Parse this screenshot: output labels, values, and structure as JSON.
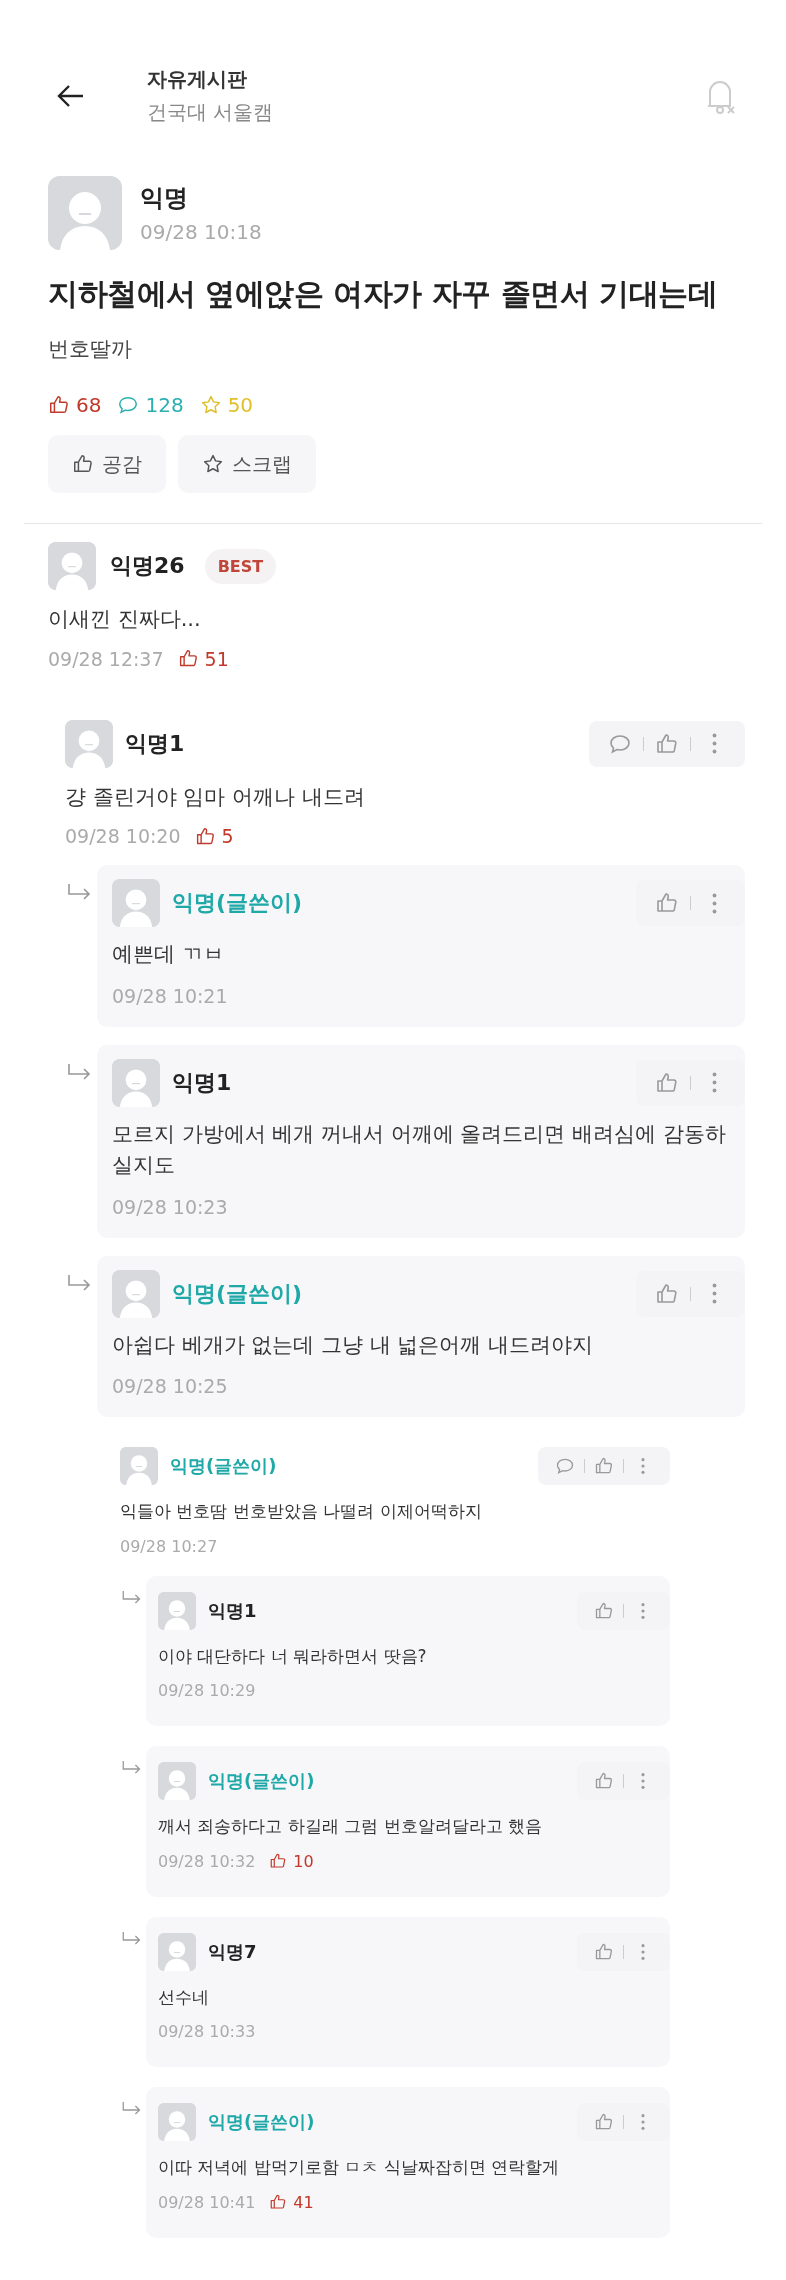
{
  "header": {
    "title": "자유게시판",
    "subtitle": "건국대 서울캠"
  },
  "post": {
    "author": "익명",
    "time": "09/28 10:18",
    "title": "지하철에서 옆에앉은 여자가 자꾸 졸면서 기대는데",
    "body": "번호딸까",
    "stats": {
      "likes": "68",
      "comments": "128",
      "scraps": "50"
    },
    "buttons": [
      {
        "kind": "like",
        "label": "공감"
      },
      {
        "kind": "scrap",
        "label": "스크랩"
      }
    ]
  },
  "best_comment": {
    "author": "익명26",
    "badge": "BEST",
    "body": "이새낀 진짜다...",
    "time": "09/28 12:37",
    "likes": "51"
  },
  "threads": [
    {
      "author": "익명1",
      "writer": false,
      "body": "걍 졸린거야 임마 어깨나 내드려",
      "time": "09/28 10:20",
      "likes": "5",
      "actions": [
        {
          "kind": "reply"
        },
        {
          "kind": "like"
        },
        {
          "kind": "more"
        }
      ],
      "replies": [
        {
          "author": "익명(글쓴이)",
          "writer": true,
          "body": "예쁜데 ㄲㅂ",
          "time": "09/28 10:21",
          "actions": [
            {
              "kind": "like"
            },
            {
              "kind": "more"
            }
          ]
        },
        {
          "author": "익명1",
          "writer": false,
          "body": "모르지 가방에서 베개 꺼내서 어깨에 올려드리면 배려심에 감동하실지도",
          "time": "09/28 10:23",
          "actions": [
            {
              "kind": "like"
            },
            {
              "kind": "more"
            }
          ]
        },
        {
          "author": "익명(글쓴이)",
          "writer": true,
          "body": "아쉽다 베개가 없는데 그냥 내 넓은어깨 내드려야지",
          "time": "09/28 10:25",
          "actions": [
            {
              "kind": "like"
            },
            {
              "kind": "more"
            }
          ]
        }
      ]
    },
    {
      "author": "익명(글쓴이)",
      "writer": true,
      "body": "익들아 번호땀 번호받았음 나떨려 이제어떡하지",
      "time": "09/28 10:27",
      "actions": [
        {
          "kind": "reply"
        },
        {
          "kind": "like"
        },
        {
          "kind": "more"
        }
      ],
      "replies": [
        {
          "author": "익명1",
          "writer": false,
          "body": "이야 대단하다 너 뭐라하면서 땃음?",
          "time": "09/28 10:29",
          "actions": [
            {
              "kind": "like"
            },
            {
              "kind": "more"
            }
          ]
        },
        {
          "author": "익명(글쓴이)",
          "writer": true,
          "body": "깨서 죄송하다고 하길래 그럼 번호알려달라고 했음",
          "time": "09/28 10:32",
          "likes": "10",
          "actions": [
            {
              "kind": "like"
            },
            {
              "kind": "more"
            }
          ]
        },
        {
          "author": "익명7",
          "writer": false,
          "body": "선수네",
          "time": "09/28 10:33",
          "actions": [
            {
              "kind": "like"
            },
            {
              "kind": "more"
            }
          ]
        },
        {
          "author": "익명(글쓴이)",
          "writer": true,
          "body": "이따 저녁에 밥먹기로함 ㅁㅊ 식날짜잡히면 연락할게",
          "time": "09/28 10:41",
          "likes": "41",
          "actions": [
            {
              "kind": "like"
            },
            {
              "kind": "more"
            }
          ]
        }
      ]
    }
  ]
}
